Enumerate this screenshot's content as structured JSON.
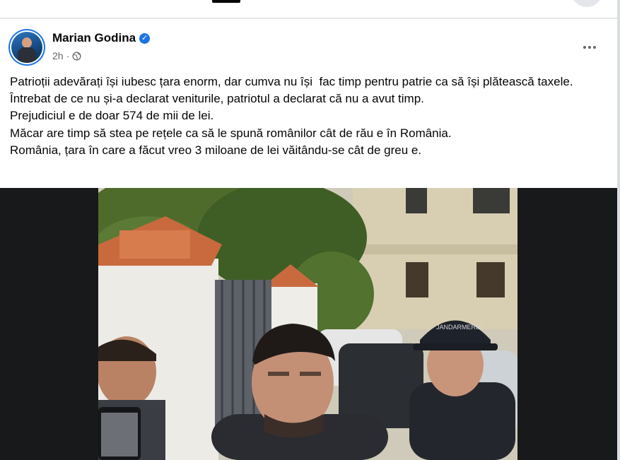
{
  "post": {
    "author_name": "Marian Godina",
    "timestamp": "2h",
    "dot": "·",
    "text_lines": [
      "Patrioții adevărați își iubesc țara enorm, dar cumva nu își  fac timp pentru patrie ca să își plătească taxele.",
      "Întrebat de ce nu și-a declarat veniturile, patriotul a declarat că nu a avut timp.",
      "Prejudiciul e de doar 574 de mii de lei.",
      "Măcar are timp să stea pe rețele ca să le spună românilor cât de rău e în România.",
      "România, țara în care a făcut vreo 3 miloane de lei văitându-se cât de greu e."
    ],
    "photo": {
      "cap_text": "JANDARMERIA"
    }
  },
  "icons": {
    "verified": "verified-badge-icon",
    "audience": "globe-icon",
    "more": "more-options-icon"
  },
  "colors": {
    "accent": "#1b74e4",
    "secondary_text": "#65676b"
  }
}
